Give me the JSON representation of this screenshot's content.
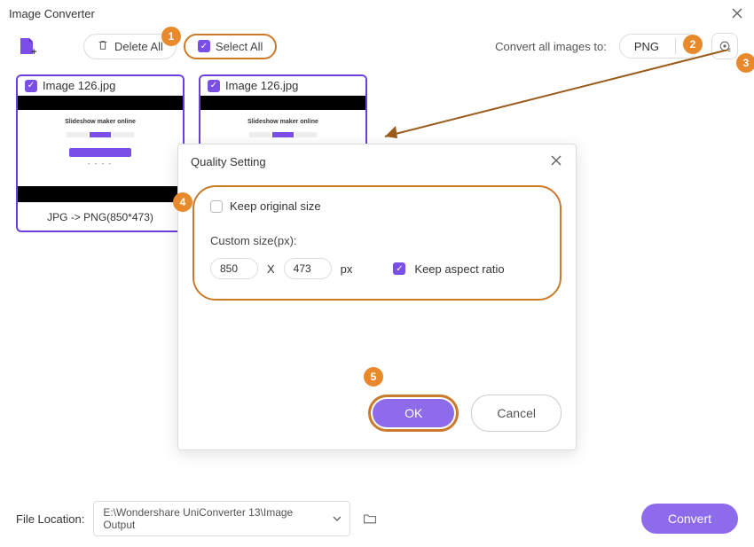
{
  "window": {
    "title": "Image Converter"
  },
  "toolbar": {
    "delete_all": "Delete All",
    "select_all": "Select All",
    "convert_label": "Convert all images to:",
    "format": "PNG"
  },
  "cards": [
    {
      "name": "Image 126.jpg",
      "thumb_title": "Slideshow maker online",
      "footer": "JPG -> PNG(850*473)"
    },
    {
      "name": "Image 126.jpg",
      "thumb_title": "Slideshow maker online",
      "footer": ""
    }
  ],
  "dialog": {
    "title": "Quality Setting",
    "keep_original": "Keep original size",
    "custom_label": "Custom size(px):",
    "width": "850",
    "x": "X",
    "height": "473",
    "unit": "px",
    "keep_aspect": "Keep aspect ratio",
    "ok": "OK",
    "cancel": "Cancel"
  },
  "bottom": {
    "label": "File Location:",
    "path": "E:\\Wondershare UniConverter 13\\Image Output",
    "convert": "Convert"
  },
  "callouts": {
    "c1": "1",
    "c2": "2",
    "c3": "3",
    "c4": "4",
    "c5": "5"
  }
}
